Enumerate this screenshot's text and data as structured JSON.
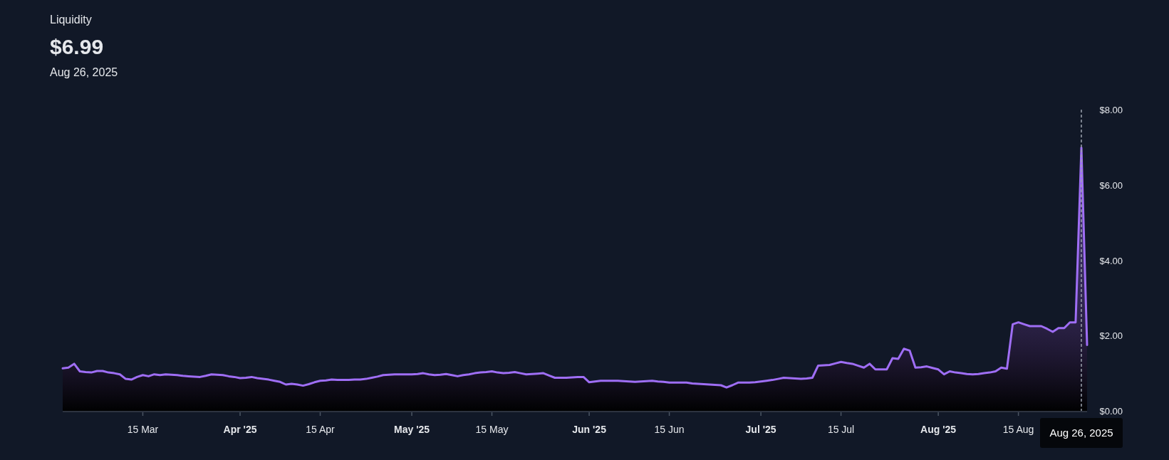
{
  "header": {
    "title": "Liquidity",
    "value": "$6.99",
    "date": "Aug 26, 2025"
  },
  "chart": {
    "chart_data": {
      "type": "area",
      "categories": [
        null,
        null,
        null,
        null,
        null,
        null,
        null,
        null,
        null,
        null,
        null,
        null,
        null,
        null,
        "15 Mar",
        null,
        null,
        null,
        null,
        null,
        null,
        null,
        null,
        null,
        null,
        null,
        null,
        null,
        null,
        null,
        null,
        "Apr '25",
        null,
        null,
        null,
        null,
        null,
        null,
        null,
        null,
        null,
        null,
        null,
        null,
        null,
        "15 Apr",
        null,
        null,
        null,
        null,
        null,
        null,
        null,
        null,
        null,
        null,
        null,
        null,
        null,
        null,
        null,
        "May '25",
        null,
        null,
        null,
        null,
        null,
        null,
        null,
        null,
        null,
        null,
        null,
        null,
        null,
        "15 May",
        null,
        null,
        null,
        null,
        null,
        null,
        null,
        null,
        null,
        null,
        null,
        null,
        null,
        null,
        null,
        null,
        "Jun '25",
        null,
        null,
        null,
        null,
        null,
        null,
        null,
        null,
        null,
        null,
        null,
        null,
        null,
        "15 Jun",
        null,
        null,
        null,
        null,
        null,
        null,
        null,
        null,
        null,
        null,
        null,
        null,
        null,
        null,
        null,
        "Jul '25",
        null,
        null,
        null,
        null,
        null,
        null,
        null,
        null,
        null,
        null,
        null,
        null,
        null,
        "15 Jul",
        null,
        null,
        null,
        null,
        null,
        null,
        null,
        null,
        null,
        null,
        null,
        null,
        null,
        null,
        null,
        null,
        "Aug '25",
        null,
        null,
        null,
        null,
        null,
        null,
        null,
        null,
        null,
        null,
        null,
        null,
        null,
        "15 Aug",
        null,
        null,
        null,
        null,
        null,
        null,
        null,
        null,
        null,
        null,
        null,
        null
      ],
      "series": [
        {
          "color": "#9f6ef5",
          "values": [
            1.13,
            1.15,
            1.25,
            1.05,
            1.03,
            1.02,
            1.06,
            1.06,
            1.02,
            1.0,
            0.97,
            0.85,
            0.83,
            0.9,
            0.95,
            0.92,
            0.97,
            0.95,
            0.97,
            0.96,
            0.95,
            0.93,
            0.92,
            0.91,
            0.9,
            0.93,
            0.97,
            0.96,
            0.95,
            0.92,
            0.9,
            0.87,
            0.88,
            0.9,
            0.87,
            0.85,
            0.83,
            0.8,
            0.77,
            0.7,
            0.72,
            0.7,
            0.67,
            0.71,
            0.76,
            0.8,
            0.81,
            0.83,
            0.82,
            0.82,
            0.82,
            0.83,
            0.83,
            0.85,
            0.88,
            0.91,
            0.95,
            0.96,
            0.97,
            0.97,
            0.97,
            0.97,
            0.98,
            1.0,
            0.97,
            0.95,
            0.96,
            0.98,
            0.95,
            0.92,
            0.95,
            0.97,
            1.0,
            1.02,
            1.03,
            1.05,
            1.02,
            1.0,
            1.01,
            1.03,
            1.0,
            0.97,
            0.98,
            0.99,
            1.0,
            0.94,
            0.88,
            0.88,
            0.88,
            0.89,
            0.9,
            0.9,
            0.76,
            0.78,
            0.8,
            0.8,
            0.8,
            0.8,
            0.79,
            0.78,
            0.77,
            0.78,
            0.79,
            0.8,
            0.78,
            0.77,
            0.75,
            0.75,
            0.75,
            0.75,
            0.73,
            0.72,
            0.71,
            0.7,
            0.69,
            0.68,
            0.62,
            0.68,
            0.75,
            0.75,
            0.75,
            0.76,
            0.78,
            0.8,
            0.82,
            0.85,
            0.88,
            0.87,
            0.86,
            0.85,
            0.86,
            0.88,
            1.2,
            1.21,
            1.22,
            1.26,
            1.3,
            1.27,
            1.25,
            1.2,
            1.15,
            1.25,
            1.1,
            1.1,
            1.1,
            1.4,
            1.38,
            1.65,
            1.6,
            1.15,
            1.16,
            1.18,
            1.14,
            1.1,
            0.97,
            1.05,
            1.02,
            1.0,
            0.98,
            0.97,
            0.98,
            1.0,
            1.02,
            1.05,
            1.15,
            1.12,
            2.3,
            2.35,
            2.3,
            2.25,
            2.25,
            2.25,
            2.18,
            2.1,
            2.2,
            2.2,
            2.35,
            2.35,
            6.99,
            1.75
          ]
        }
      ],
      "ylim": [
        0,
        8
      ],
      "yticks": [
        {
          "value": 0,
          "label": "$0.00"
        },
        {
          "value": 2,
          "label": "$2.00"
        },
        {
          "value": 4,
          "label": "$4.00"
        },
        {
          "value": 6,
          "label": "$6.00"
        },
        {
          "value": 8,
          "label": "$8.00"
        }
      ],
      "annotations": [
        "Aug 26, 2025"
      ]
    },
    "xtick_bold": [
      false,
      true,
      false,
      true,
      false,
      true,
      false,
      true,
      false,
      true,
      false
    ]
  }
}
